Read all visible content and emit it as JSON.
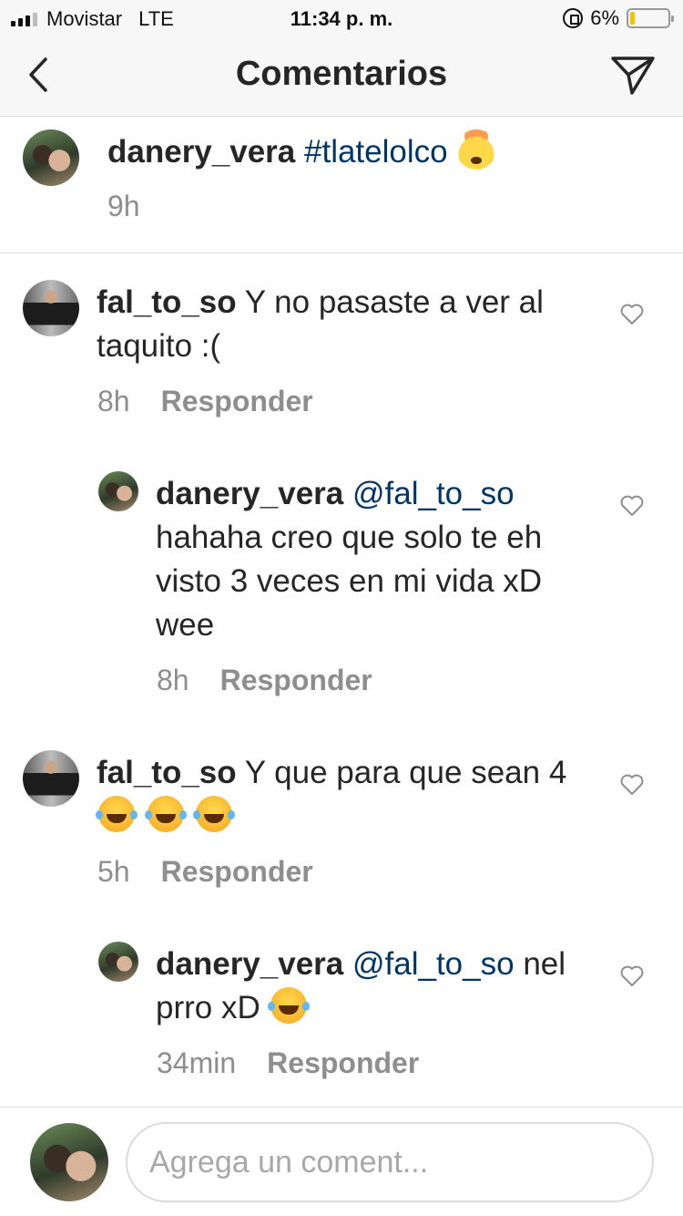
{
  "status_bar": {
    "carrier": "Movistar",
    "network": "LTE",
    "time": "11:34 p. m.",
    "battery_text": "6%",
    "battery_level": 0.06,
    "battery_color": "#f5c400"
  },
  "nav": {
    "title": "Comentarios",
    "back_icon": "chevron-left-icon",
    "send_icon": "paper-plane-icon"
  },
  "caption": {
    "username": "danery_vera",
    "hashtag": "#tlatelolco",
    "emoji": "exploding-head-emoji",
    "time": "9h"
  },
  "comments": [
    {
      "username": "fal_to_so",
      "text": "Y no pasaste a ver al taquito :(",
      "time": "8h",
      "reply_label": "Responder"
    },
    {
      "username": "danery_vera",
      "mention": "@fal_to_so",
      "text": "hahaha creo que solo te eh visto 3 veces en mi vida xD wee",
      "time": "8h",
      "reply_label": "Responder"
    },
    {
      "username": "fal_to_so",
      "text": "Y que para que sean 4",
      "emoji": "face-with-tears-of-joy-emoji",
      "time": "5h",
      "reply_label": "Responder"
    },
    {
      "username": "danery_vera",
      "mention": "@fal_to_so",
      "text": "nel prro xD",
      "emoji": "face-with-tears-of-joy-emoji",
      "time": "34min",
      "reply_label": "Responder"
    }
  ],
  "composer": {
    "placeholder": "Agrega un coment..."
  },
  "colors": {
    "link": "#003569",
    "meta": "#8e8e8e",
    "text": "#262626",
    "bar_bg": "#f7f7f7"
  }
}
